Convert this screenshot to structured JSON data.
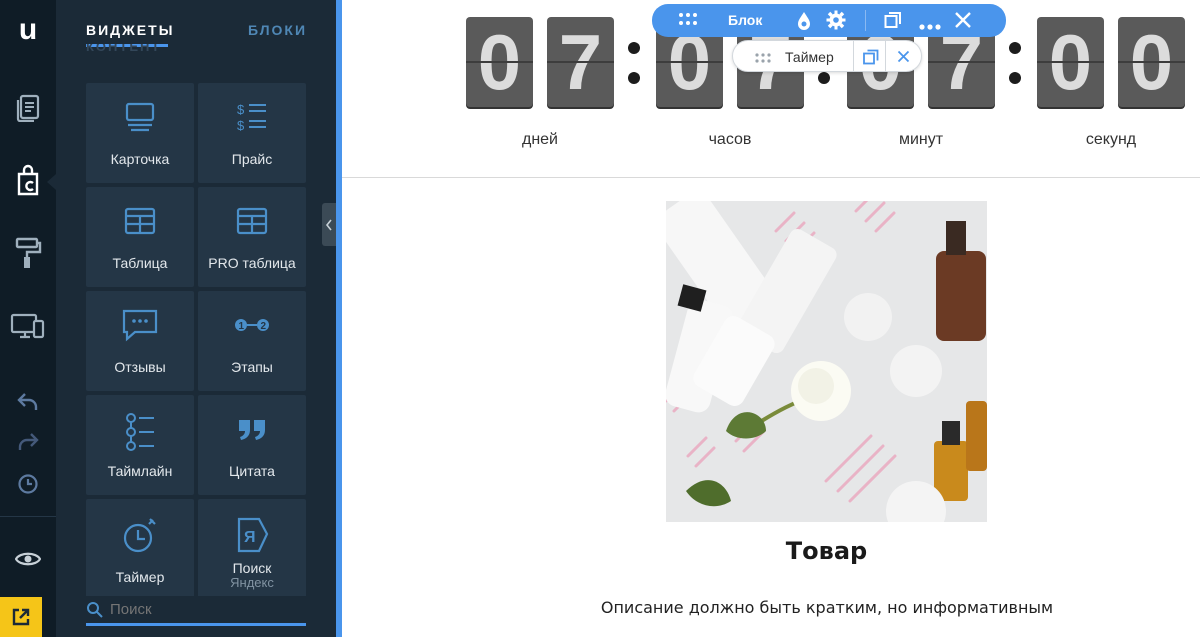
{
  "app": {
    "logo": "u"
  },
  "rail": {
    "items": [
      "pages-icon",
      "widgets-icon",
      "design-roller-icon",
      "devices-icon",
      "undo-icon",
      "redo-icon",
      "history-icon",
      "preview-eye-icon",
      "publish-icon"
    ]
  },
  "panel": {
    "tabs": [
      {
        "label": "ВИДЖЕТЫ",
        "active": true
      },
      {
        "label": "БЛОКИ",
        "active": false
      }
    ],
    "section_label": "КОНТЕНТ",
    "widgets": [
      {
        "label": "Карточка",
        "icon": "card-icon"
      },
      {
        "label": "Прайс",
        "icon": "price-list-icon"
      },
      {
        "label": "Таблица",
        "icon": "table-icon"
      },
      {
        "label": "PRO таблица",
        "icon": "pro-table-icon"
      },
      {
        "label": "Отзывы",
        "icon": "reviews-icon"
      },
      {
        "label": "Этапы",
        "icon": "steps-icon"
      },
      {
        "label": "Таймлайн",
        "icon": "timeline-icon"
      },
      {
        "label": "Цитата",
        "icon": "quote-icon"
      },
      {
        "label": "Таймер",
        "icon": "timer-icon"
      },
      {
        "label": "Поиск",
        "sublabel": "Яндекс",
        "icon": "yandex-search-icon"
      }
    ],
    "search": {
      "placeholder": "Поиск"
    }
  },
  "block_toolbar": {
    "label": "Блок"
  },
  "element_toolbar": {
    "label": "Таймер"
  },
  "timer": {
    "digits": [
      "0",
      "7",
      "0",
      "7",
      "0",
      "7",
      "0",
      "0"
    ],
    "units": [
      "дней",
      "часов",
      "минут",
      "секунд"
    ]
  },
  "product": {
    "title": "Товар",
    "description": "Описание должно быть кратким, но информативным"
  },
  "colors": {
    "accent": "#4a95ec",
    "rail": "#0f1c26",
    "panel": "#1b2a37",
    "tile": "#243646",
    "publish": "#f5c518"
  }
}
